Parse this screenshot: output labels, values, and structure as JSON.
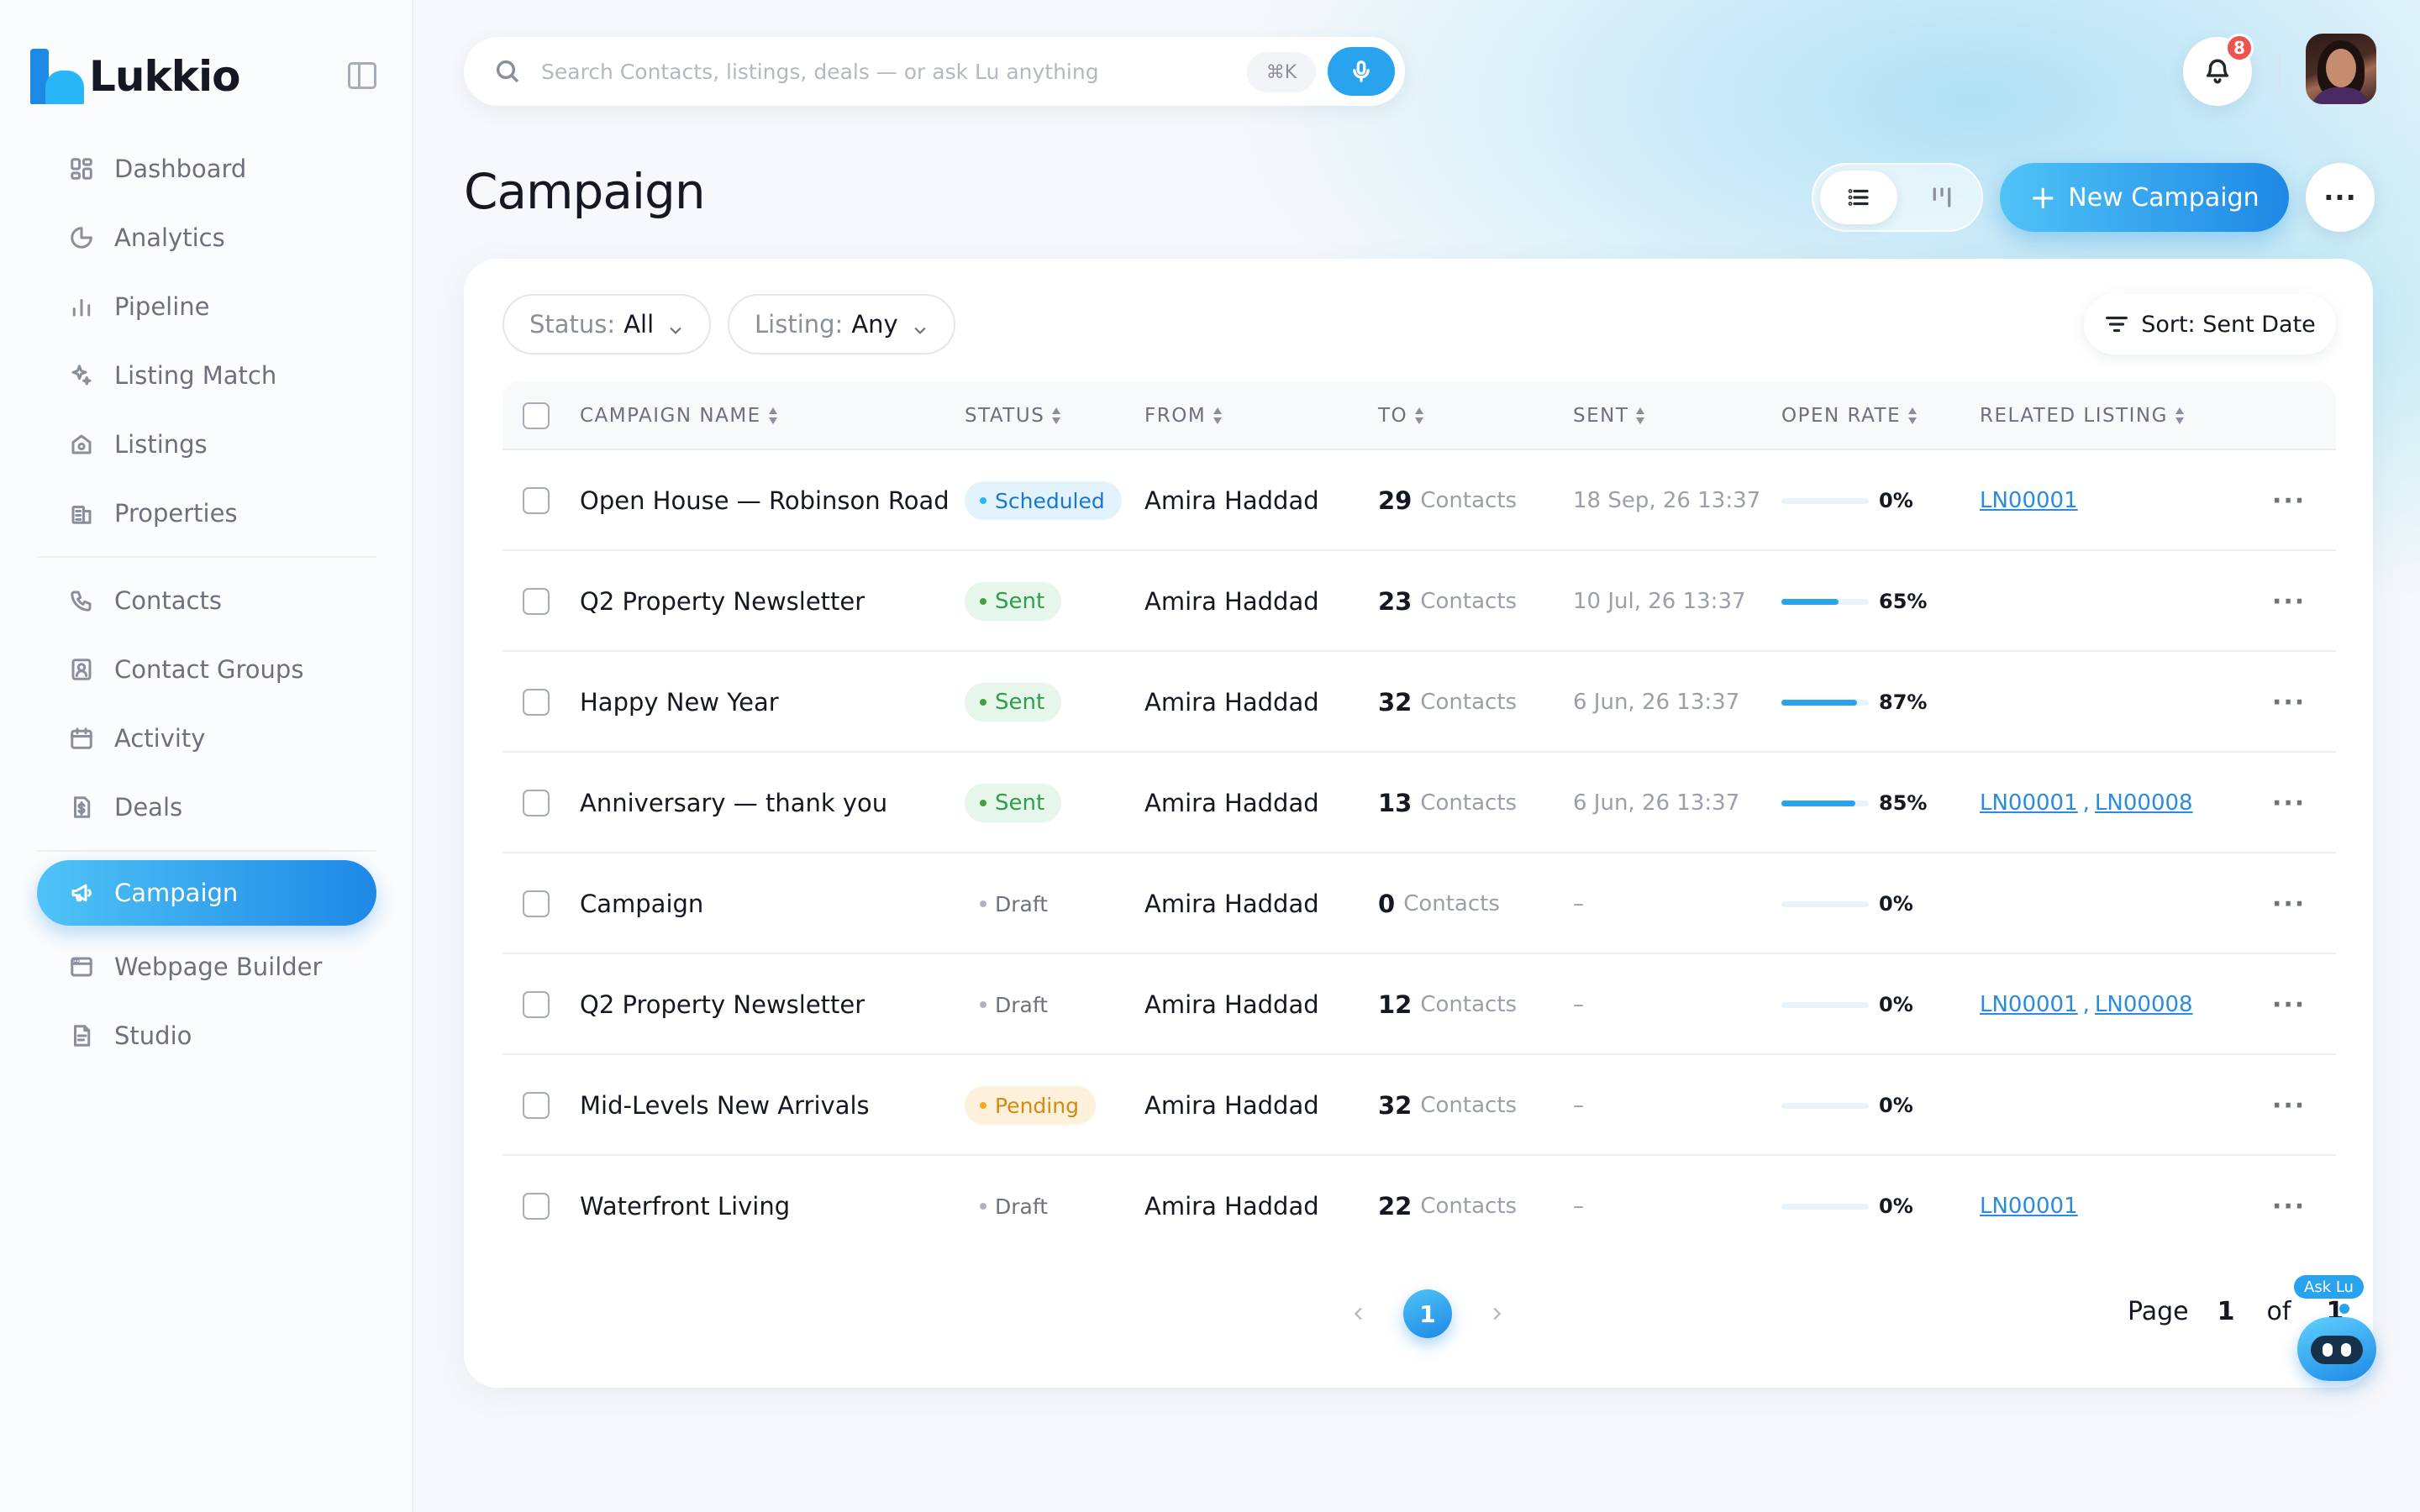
{
  "app": {
    "brand": "Lukkio",
    "accent": "#2aa3ee",
    "accent_dark": "#1e88e5"
  },
  "sidebar": {
    "items": [
      {
        "label": "Dashboard",
        "icon": "dashboard-icon"
      },
      {
        "label": "Analytics",
        "icon": "pie-chart-icon"
      },
      {
        "label": "Pipeline",
        "icon": "bar-chart-icon"
      },
      {
        "label": "Listing Match",
        "icon": "sparkles-icon"
      },
      {
        "label": "Listings",
        "icon": "home-icon"
      },
      {
        "label": "Properties",
        "icon": "building-icon"
      },
      {
        "label": "Contacts",
        "icon": "phone-icon"
      },
      {
        "label": "Contact Groups",
        "icon": "contact-card-icon"
      },
      {
        "label": "Activity",
        "icon": "calendar-icon"
      },
      {
        "label": "Deals",
        "icon": "document-dollar-icon"
      },
      {
        "label": "Campaign",
        "icon": "megaphone-icon",
        "active": true
      },
      {
        "label": "Webpage Builder",
        "icon": "browser-window-icon"
      },
      {
        "label": "Studio",
        "icon": "document-icon"
      }
    ]
  },
  "topbar": {
    "search_placeholder": "Search Contacts, listings, deals — or ask Lu anything",
    "shortcut": "⌘K",
    "notifications_count": "8"
  },
  "page": {
    "title": "Campaign",
    "new_button_label": "New Campaign",
    "more_label": "···"
  },
  "filters": {
    "status_label": "Status:",
    "status_value": "All",
    "listing_label": "Listing:",
    "listing_value": "Any",
    "sort_label": "Sort: Sent Date"
  },
  "table": {
    "columns": [
      "CAMPAIGN NAME",
      "STATUS",
      "FROM",
      "TO",
      "SENT",
      "OPEN RATE",
      "RELATED LISTING"
    ],
    "contacts_unit": "Contacts",
    "rows": [
      {
        "name": "Open House — Robinson Road",
        "status": "Scheduled",
        "status_kind": "scheduled",
        "from": "Amira Haddad",
        "to": "29",
        "sent": "18 Sep, 26 13:37",
        "open_rate": 0,
        "open_rate_label": "0%",
        "listings": [
          "LN00001"
        ]
      },
      {
        "name": "Q2 Property Newsletter",
        "status": "Sent",
        "status_kind": "sent",
        "from": "Amira Haddad",
        "to": "23",
        "sent": "10 Jul, 26 13:37",
        "open_rate": 65,
        "open_rate_label": "65%",
        "listings": []
      },
      {
        "name": "Happy New Year",
        "status": "Sent",
        "status_kind": "sent",
        "from": "Amira Haddad",
        "to": "32",
        "sent": "6 Jun, 26 13:37",
        "open_rate": 87,
        "open_rate_label": "87%",
        "listings": []
      },
      {
        "name": "Anniversary — thank you",
        "status": "Sent",
        "status_kind": "sent",
        "from": "Amira Haddad",
        "to": "13",
        "sent": "6 Jun, 26 13:37",
        "open_rate": 85,
        "open_rate_label": "85%",
        "listings": [
          "LN00001",
          "LN00008"
        ]
      },
      {
        "name": "Campaign",
        "status": "Draft",
        "status_kind": "draft",
        "from": "Amira Haddad",
        "to": "0",
        "sent": "–",
        "open_rate": 0,
        "open_rate_label": "0%",
        "listings": []
      },
      {
        "name": "Q2 Property Newsletter",
        "status": "Draft",
        "status_kind": "draft",
        "from": "Amira Haddad",
        "to": "12",
        "sent": "–",
        "open_rate": 0,
        "open_rate_label": "0%",
        "listings": [
          "LN00001",
          "LN00008"
        ]
      },
      {
        "name": "Mid-Levels New Arrivals",
        "status": "Pending",
        "status_kind": "pending",
        "from": "Amira Haddad",
        "to": "32",
        "sent": "–",
        "open_rate": 0,
        "open_rate_label": "0%",
        "listings": []
      },
      {
        "name": "Waterfront Living",
        "status": "Draft",
        "status_kind": "draft",
        "from": "Amira Haddad",
        "to": "22",
        "sent": "–",
        "open_rate": 0,
        "open_rate_label": "0%",
        "listings": [
          "LN00001"
        ]
      }
    ]
  },
  "pagination": {
    "current": "1",
    "page_label": "Page",
    "page_number": "1",
    "of_label": "of",
    "total": "1"
  },
  "assistant": {
    "label": "Ask Lu"
  }
}
